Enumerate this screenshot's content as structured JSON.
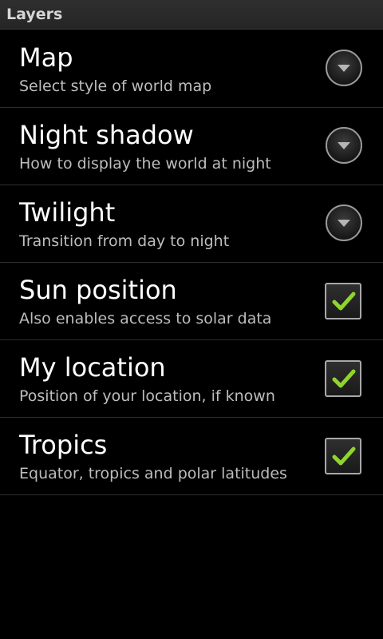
{
  "header": {
    "title": "Layers"
  },
  "preferences": [
    {
      "label": "Map",
      "summary": "Select style of world map",
      "control": "dropdown"
    },
    {
      "label": "Night shadow",
      "summary": "How to display the world at night",
      "control": "dropdown"
    },
    {
      "label": "Twilight",
      "summary": "Transition from day to night",
      "control": "dropdown"
    },
    {
      "label": "Sun position",
      "summary": "Also enables access to solar data",
      "control": "checkbox",
      "checked": true
    },
    {
      "label": "My location",
      "summary": "Position of your location, if known",
      "control": "checkbox",
      "checked": true
    },
    {
      "label": "Tropics",
      "summary": "Equator, tropics and polar latitudes",
      "control": "checkbox",
      "checked": true
    }
  ],
  "colors": {
    "background": "#000000",
    "check": "#8fd62a",
    "label": "#ffffff",
    "summary": "#bdbdbd"
  },
  "icons": {
    "dropdown": "chevron-down-icon",
    "check": "checkmark-icon"
  }
}
